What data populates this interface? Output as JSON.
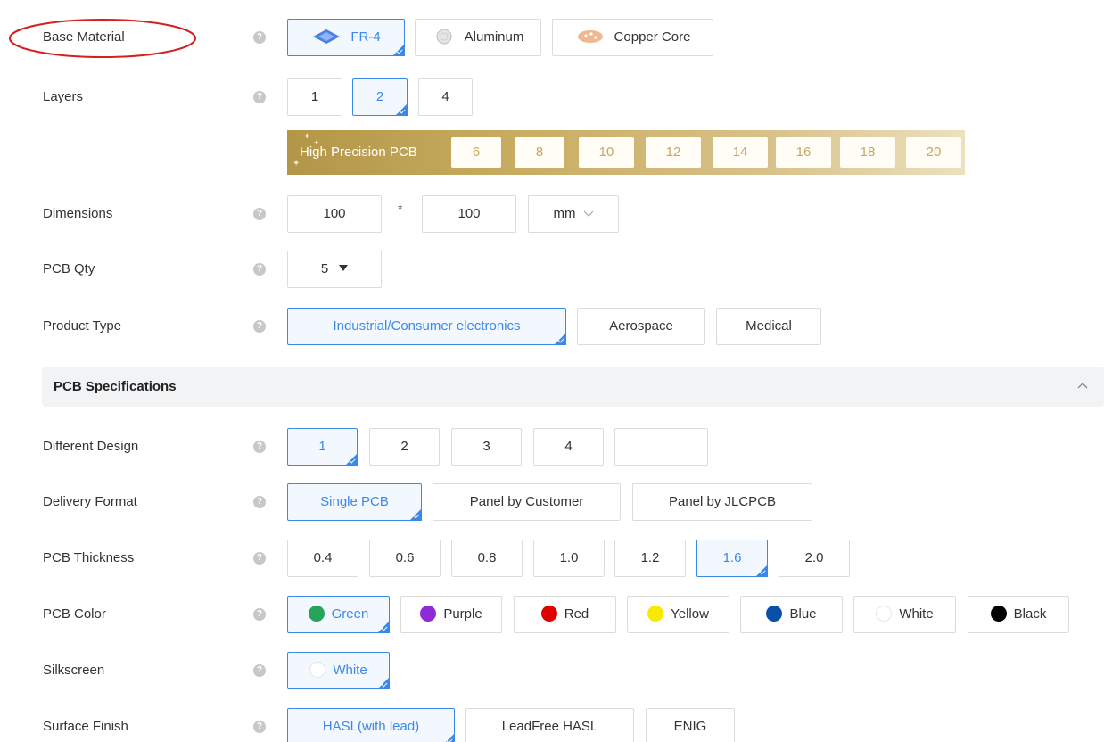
{
  "help_glyph": "?",
  "base_material": {
    "label": "Base Material",
    "options": [
      {
        "text": "FR-4",
        "icon": "fr4-material-icon",
        "selected": true
      },
      {
        "text": "Aluminum",
        "icon": "aluminum-material-icon",
        "selected": false
      },
      {
        "text": "Copper Core",
        "icon": "copper-core-material-icon",
        "selected": false
      }
    ]
  },
  "layers": {
    "label": "Layers",
    "options": [
      "1",
      "2",
      "4"
    ],
    "selected": "2",
    "high_precision": {
      "label": "High Precision PCB",
      "options": [
        "6",
        "8",
        "10",
        "12",
        "14",
        "16",
        "18",
        "20"
      ]
    }
  },
  "dimensions": {
    "label": "Dimensions",
    "width": "100",
    "separator": "*",
    "height": "100",
    "unit": "mm"
  },
  "pcb_qty": {
    "label": "PCB Qty",
    "value": "5"
  },
  "product_type": {
    "label": "Product Type",
    "options": [
      "Industrial/Consumer electronics",
      "Aerospace",
      "Medical"
    ],
    "selected": "Industrial/Consumer electronics"
  },
  "pcb_specifications": {
    "title": "PCB Specifications"
  },
  "different_design": {
    "label": "Different Design",
    "options": [
      "1",
      "2",
      "3",
      "4",
      ""
    ],
    "selected": "1"
  },
  "delivery_format": {
    "label": "Delivery Format",
    "options": [
      "Single PCB",
      "Panel by Customer",
      "Panel by JLCPCB"
    ],
    "selected": "Single PCB"
  },
  "pcb_thickness": {
    "label": "PCB Thickness",
    "options": [
      "0.4",
      "0.6",
      "0.8",
      "1.0",
      "1.2",
      "1.6",
      "2.0"
    ],
    "selected": "1.6"
  },
  "pcb_color": {
    "label": "PCB Color",
    "options": [
      {
        "text": "Green",
        "color": "#27a35a"
      },
      {
        "text": "Purple",
        "color": "#8e2bd6"
      },
      {
        "text": "Red",
        "color": "#e00000"
      },
      {
        "text": "Yellow",
        "color": "#f7ea00"
      },
      {
        "text": "Blue",
        "color": "#0a4fa8"
      },
      {
        "text": "White",
        "color": "#ffffff"
      },
      {
        "text": "Black",
        "color": "#000000"
      }
    ],
    "selected": "Green"
  },
  "silkscreen": {
    "label": "Silkscreen",
    "options": [
      {
        "text": "White",
        "color": "#ffffff"
      }
    ],
    "selected": "White"
  },
  "surface_finish": {
    "label": "Surface Finish",
    "options": [
      "HASL(with lead)",
      "LeadFree HASL",
      "ENIG"
    ],
    "selected": "HASL(with lead)"
  },
  "colors": {
    "accent": "#3c88e8",
    "annotation": "#d42020",
    "gold": "#c6a866"
  }
}
